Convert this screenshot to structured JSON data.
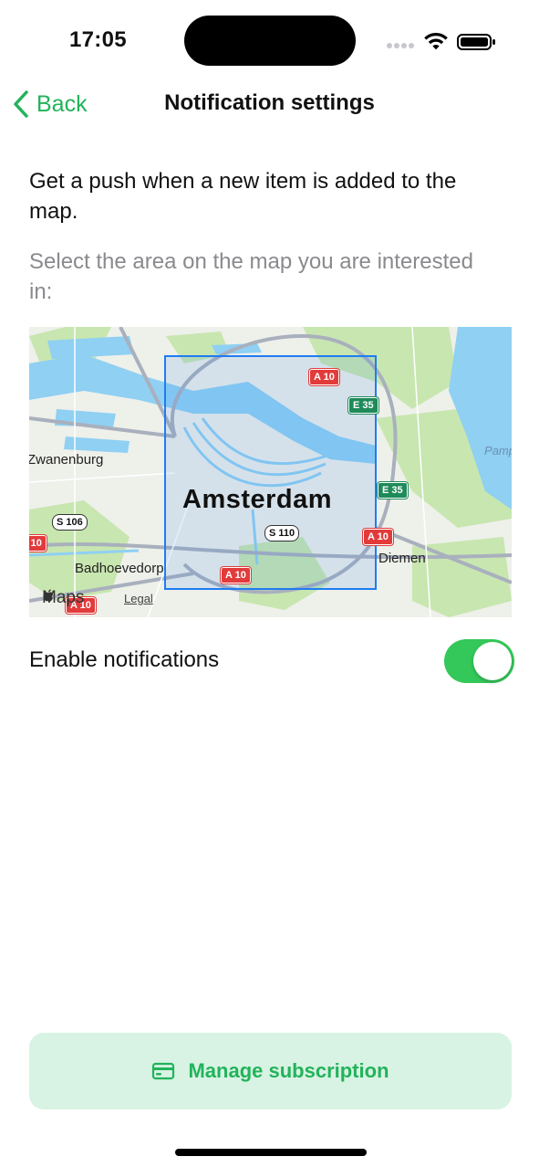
{
  "status_bar": {
    "time": "17:05",
    "icons": [
      "signal-dots-icon",
      "wifi-icon",
      "battery-icon"
    ]
  },
  "nav": {
    "back_label": "Back",
    "back_icon": "chevron-left-icon",
    "title": "Notification settings"
  },
  "content": {
    "intro": "Get a push when a new item is added to the map.",
    "hint": "Select the area on the map you are interested in:"
  },
  "map": {
    "city": "Amsterdam",
    "places": [
      "Zwanenburg",
      "Badhoevedorp",
      "Diemen",
      "Pamp"
    ],
    "road_shields": [
      "A 10",
      "E 35",
      "E 35",
      "A 10",
      "A 10",
      "S 106",
      "S 110",
      "A 10",
      "A 10"
    ],
    "attribution": "Maps",
    "legal_label": "Legal"
  },
  "notifications": {
    "label": "Enable notifications",
    "enabled": true
  },
  "subscription": {
    "button_label": "Manage subscription",
    "icon": "credit-card-icon"
  },
  "colors": {
    "accent": "#22b35b",
    "toggle_on": "#34c759",
    "button_bg": "#d8f3e3",
    "selection": "#1f7cf2"
  }
}
